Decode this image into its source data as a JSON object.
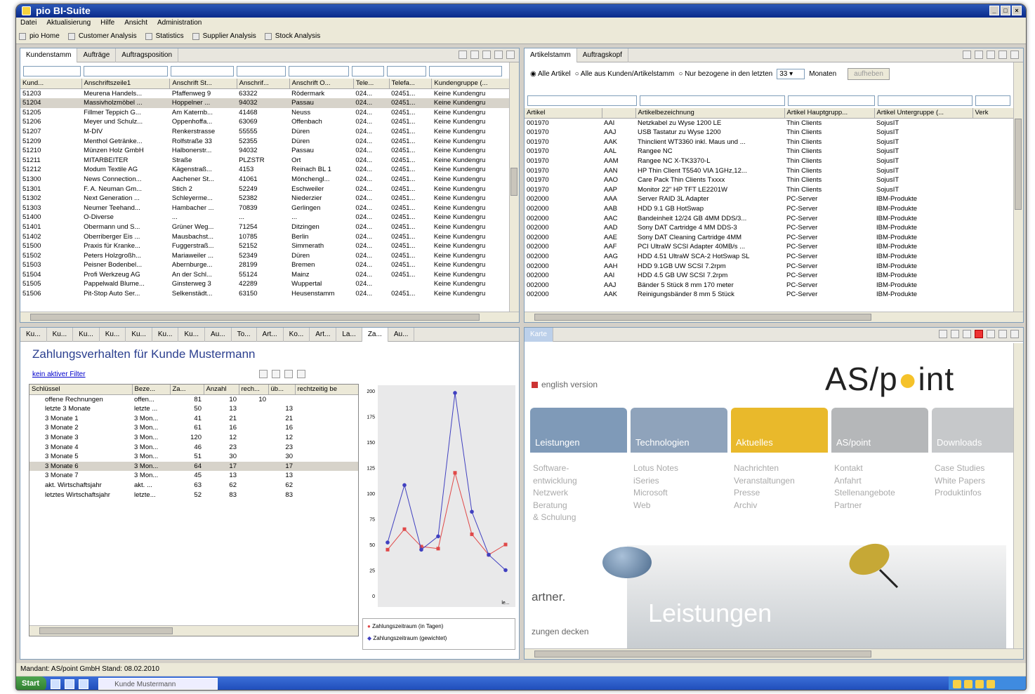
{
  "window": {
    "title": "pio BI-Suite"
  },
  "menu": [
    "Datei",
    "Aktualisierung",
    "Hilfe",
    "Ansicht",
    "Administration"
  ],
  "toolbar": [
    "pio Home",
    "Customer Analysis",
    "Statistics",
    "Supplier Analysis",
    "Stock Analysis"
  ],
  "kunden": {
    "tabs": [
      "Kundenstamm",
      "Aufträge",
      "Auftragsposition"
    ],
    "headers": [
      "Kund...",
      "Anschriftszeile1",
      "Anschrift St...",
      "Anschrif...",
      "Anschrift O...",
      "Tele...",
      "Telefa...",
      "Kundengruppe (..."
    ],
    "rows": [
      [
        "51203",
        "Meurena Handels...",
        "Pfaffenweg 9",
        "63322",
        "Rödermark",
        "024...",
        "02451...",
        "Keine Kundengru"
      ],
      [
        "51204",
        "Massivholzmöbel ...",
        "Hoppelner ...",
        "94032",
        "Passau",
        "024...",
        "02451...",
        "Keine Kundengru"
      ],
      [
        "51205",
        "Fillmer Teppich G...",
        "Am Katernb...",
        "41468",
        "Neuss",
        "024...",
        "02451...",
        "Keine Kundengru"
      ],
      [
        "51206",
        "Meyer und Schulz...",
        "Oppenhoffa...",
        "63069",
        "Offenbach",
        "024...",
        "02451...",
        "Keine Kundengru"
      ],
      [
        "51207",
        "M-DIV",
        "Renkerstrasse",
        "55555",
        "Düren",
        "024...",
        "02451...",
        "Keine Kundengru"
      ],
      [
        "51209",
        "Menthol Getränke...",
        "Rolfstraße 33",
        "52355",
        "Düren",
        "024...",
        "02451...",
        "Keine Kundengru"
      ],
      [
        "51210",
        "Münzen Holz GmbH",
        "Halbonerstr...",
        "94032",
        "Passau",
        "024...",
        "02451...",
        "Keine Kundengru"
      ],
      [
        "51211",
        "MITARBEITER",
        "Straße",
        "PLZSTR",
        "Ort",
        "024...",
        "02451...",
        "Keine Kundengru"
      ],
      [
        "51212",
        "Modum Textile AG",
        "Kägenstraß...",
        "4153",
        "Reinach BL 1",
        "024...",
        "02451...",
        "Keine Kundengru"
      ],
      [
        "51300",
        "News Connection...",
        "Aachener St...",
        "41061",
        "Mönchengl...",
        "024...",
        "02451...",
        "Keine Kundengru"
      ],
      [
        "51301",
        "F. A. Neuman Gm...",
        "Stich 2",
        "52249",
        "Eschweiler",
        "024...",
        "02451...",
        "Keine Kundengru"
      ],
      [
        "51302",
        "Next Generation ...",
        "Schleyerme...",
        "52382",
        "Niederzier",
        "024...",
        "02451...",
        "Keine Kundengru"
      ],
      [
        "51303",
        "Neumer Teehand...",
        "Hambacher ...",
        "70839",
        "Gerlingen",
        "024...",
        "02451...",
        "Keine Kundengru"
      ],
      [
        "51400",
        "O-Diverse",
        "...",
        "...",
        "...",
        "024...",
        "02451...",
        "Keine Kundengru"
      ],
      [
        "51401",
        "Obermann und S...",
        "Grüner Weg...",
        "71254",
        "Ditzingen",
        "024...",
        "02451...",
        "Keine Kundengru"
      ],
      [
        "51402",
        "Oberriberger Eis ...",
        "Mausbachst...",
        "10785",
        "Berlin",
        "024...",
        "02451...",
        "Keine Kundengru"
      ],
      [
        "51500",
        "Praxis für Kranke...",
        "Fuggerstraß...",
        "52152",
        "Simmerath",
        "024...",
        "02451...",
        "Keine Kundengru"
      ],
      [
        "51502",
        "Peters Holzgroßh...",
        "Mariaweiler ...",
        "52349",
        "Düren",
        "024...",
        "02451...",
        "Keine Kundengru"
      ],
      [
        "51503",
        "Peisner Bodenbel...",
        "Abernburge...",
        "28199",
        "Bremen",
        "024...",
        "02451...",
        "Keine Kundengru"
      ],
      [
        "51504",
        "Profi Werkzeug AG",
        "An der Schl...",
        "55124",
        "Mainz",
        "024...",
        "02451...",
        "Keine Kundengru"
      ],
      [
        "51505",
        "Pappelwald Blume...",
        "Ginsterweg 3",
        "42289",
        "Wuppertal",
        "024...",
        "",
        "Keine Kundengru"
      ],
      [
        "51506",
        "Pit-Stop Auto Ser...",
        "Selkenstädt...",
        "63150",
        "Heusenstamm",
        "024...",
        "02451...",
        "Keine Kundengru"
      ]
    ]
  },
  "artikel": {
    "tabs": [
      "Artikelstamm",
      "Auftragskopf"
    ],
    "radio_all": "Alle Artikel",
    "radio_customer": "Alle aus Kunden/Artikelstamm",
    "radio_recent": "Nur bezogene in den letzten",
    "months_value": "33",
    "months_label": "Monaten",
    "apply_button": "aufheben",
    "headers": [
      "Artikel",
      "",
      "Artikelbezeichnung",
      "Artikel Hauptgrupp...",
      "Artikel Untergruppe (...",
      "Verk"
    ],
    "rows": [
      [
        "001970",
        "AAI",
        "Netzkabel zu Wyse 1200 LE",
        "Thin Clients",
        "SojusIT"
      ],
      [
        "001970",
        "AAJ",
        "USB Tastatur zu Wyse 1200",
        "Thin Clients",
        "SojusIT"
      ],
      [
        "001970",
        "AAK",
        "Thinclient WT3360 inkl. Maus und ...",
        "Thin Clients",
        "SojusIT"
      ],
      [
        "001970",
        "AAL",
        "Rangee NC",
        "Thin Clients",
        "SojusIT"
      ],
      [
        "001970",
        "AAM",
        "Rangee NC X-TK3370-L",
        "Thin Clients",
        "SojusIT"
      ],
      [
        "001970",
        "AAN",
        "HP Thin Client T5540 VIA 1GHz,12...",
        "Thin Clients",
        "SojusIT"
      ],
      [
        "001970",
        "AAO",
        "Care Pack Thin Clients Txxxx",
        "Thin Clients",
        "SojusIT"
      ],
      [
        "001970",
        "AAP",
        "Monitor 22\" HP TFT LE2201W",
        "Thin Clients",
        "SojusIT"
      ],
      [
        "002000",
        "AAA",
        "Server RAID 3L Adapter",
        "PC-Server",
        "IBM-Produkte"
      ],
      [
        "002000",
        "AAB",
        "HDD 9.1 GB HotSwap",
        "PC-Server",
        "IBM-Produkte"
      ],
      [
        "002000",
        "AAC",
        "Bandeinheit 12/24 GB 4MM DDS/3...",
        "PC-Server",
        "IBM-Produkte"
      ],
      [
        "002000",
        "AAD",
        "Sony DAT Cartridge 4 MM DDS-3",
        "PC-Server",
        "IBM-Produkte"
      ],
      [
        "002000",
        "AAE",
        "Sony DAT Cleaning Cartridge 4MM",
        "PC-Server",
        "IBM-Produkte"
      ],
      [
        "002000",
        "AAF",
        "PCI UltraW SCSI Adapter 40MB/s ...",
        "PC-Server",
        "IBM-Produkte"
      ],
      [
        "002000",
        "AAG",
        "HDD 4.51 UltraW SCA-2 HotSwap SL",
        "PC-Server",
        "IBM-Produkte"
      ],
      [
        "002000",
        "AAH",
        "HDD 9.1GB UW SCSI 7.2rpm",
        "PC-Server",
        "IBM-Produkte"
      ],
      [
        "002000",
        "AAI",
        "HDD 4.5 GB UW SCSI 7.2rpm",
        "PC-Server",
        "IBM-Produkte"
      ],
      [
        "002000",
        "AAJ",
        "Bänder 5 Stück 8 mm 170 meter",
        "PC-Server",
        "IBM-Produkte"
      ],
      [
        "002000",
        "AAK",
        "Reinigungsbänder 8 mm 5 Stück",
        "PC-Server",
        "IBM-Produkte"
      ]
    ]
  },
  "zahlung": {
    "tabs": [
      "Ku...",
      "Ku...",
      "Ku...",
      "Ku...",
      "Ku...",
      "Ku...",
      "Ku...",
      "Au...",
      "To...",
      "Art...",
      "Ko...",
      "Art...",
      "La...",
      "Za...",
      "Au..."
    ],
    "title": "Zahlungsverhalten für Kunde Mustermann",
    "filter_link": "kein aktiver Filter",
    "headers": [
      "Schlüssel",
      "Beze...",
      "Za...",
      "Anzahl",
      "rech...",
      "üb...",
      "rechtzeitig be"
    ],
    "rows": [
      [
        "offene Rechnungen",
        "offen...",
        "81",
        "10",
        "10",
        "",
        ""
      ],
      [
        "letzte 3 Monate",
        "letzte ...",
        "50",
        "13",
        "",
        "13",
        ""
      ],
      [
        "3 Monate 1",
        "3 Mon...",
        "41",
        "21",
        "",
        "21",
        ""
      ],
      [
        "3 Monate 2",
        "3 Mon...",
        "61",
        "16",
        "",
        "16",
        ""
      ],
      [
        "3 Monate 3",
        "3 Mon...",
        "120",
        "12",
        "",
        "12",
        ""
      ],
      [
        "3 Monate 4",
        "3 Mon...",
        "46",
        "23",
        "",
        "23",
        ""
      ],
      [
        "3 Monate 5",
        "3 Mon...",
        "51",
        "30",
        "",
        "30",
        ""
      ],
      [
        "3 Monate 6",
        "3 Mon...",
        "64",
        "17",
        "",
        "17",
        ""
      ],
      [
        "3 Monate 7",
        "3 Mon...",
        "45",
        "13",
        "",
        "13",
        ""
      ],
      [
        "akt. Wirtschaftsjahr",
        "akt. ...",
        "63",
        "62",
        "",
        "62",
        ""
      ],
      [
        "letztes Wirtschaftsjahr",
        "letzte...",
        "52",
        "83",
        "",
        "83",
        ""
      ]
    ]
  },
  "chart_data": {
    "type": "line",
    "x": [
      "",
      "",
      "",
      "",
      "",
      "",
      "",
      "",
      "",
      "le..."
    ],
    "ylim": [
      0,
      200
    ],
    "yticks": [
      0,
      25,
      50,
      75,
      100,
      125,
      150,
      175,
      200
    ],
    "series": [
      {
        "name": "Zahlungszeitraum (in Tagen)",
        "color": "#e04848",
        "values": [
          45,
          65,
          48,
          46,
          120,
          60,
          40,
          50
        ]
      },
      {
        "name": "Zahlungszeitraum (gewichtet)",
        "color": "#4040c0",
        "values": [
          52,
          108,
          45,
          58,
          198,
          82,
          40,
          25
        ]
      }
    ]
  },
  "karte": {
    "tab": "Karte",
    "english": "english version",
    "logo_pre": "AS/p",
    "logo_dot": "●",
    "logo_post": "int",
    "nav": [
      {
        "label": "Leistungen",
        "color": "#7f9ab8",
        "links": "Software-\nentwicklung\nNetzwerk\nBeratung\n& Schulung"
      },
      {
        "label": "Technologien",
        "color": "#8fa3bb",
        "links": "Lotus Notes\niSeries\nMicrosoft\nWeb"
      },
      {
        "label": "Aktuelles",
        "color": "#e9b92b",
        "links": "Nachrichten\nVeranstaltungen\nPresse\nArchiv"
      },
      {
        "label": "AS/point",
        "color": "#b5b7b9",
        "links": "Kontakt\nAnfahrt\nStellenangebote\nPartner"
      },
      {
        "label": "Downloads",
        "color": "#c6c8ca",
        "links": "Case Studies\nWhite Papers\nProduktinfos"
      }
    ],
    "hero_title": "Leistungen",
    "hero_side": "artner.",
    "hero_sub": "zungen decken"
  },
  "status": "Mandant: AS/point GmbH Stand: 08.02.2010",
  "taskbar": {
    "start": "Start",
    "task": "Kunde Mustermann"
  }
}
